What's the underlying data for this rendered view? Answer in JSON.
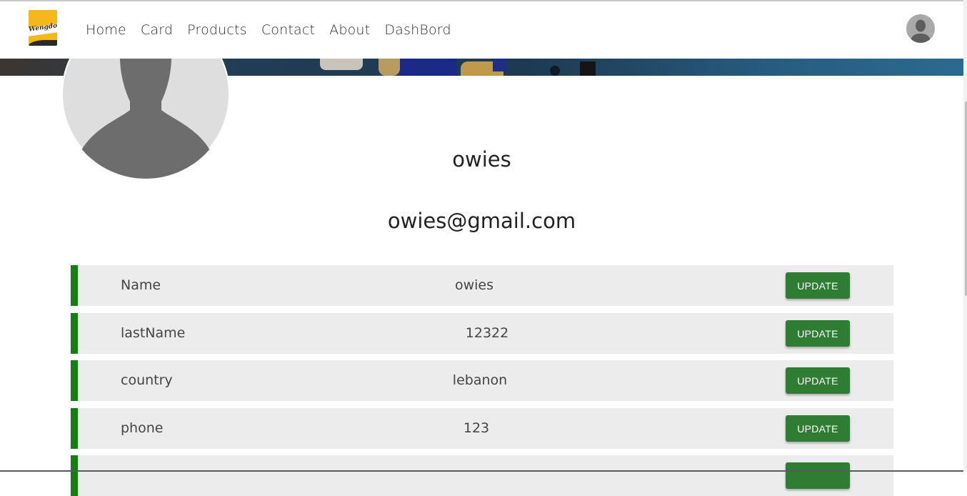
{
  "nav": {
    "logo_text": "Wengdo",
    "links": [
      "Home",
      "Card",
      "Products",
      "Contact",
      "About",
      "DashBord"
    ]
  },
  "profile": {
    "name": "owies",
    "email": "owies@gmail.com"
  },
  "rows": [
    {
      "label": "Name",
      "value": "owies",
      "button": "UPDATE"
    },
    {
      "label": "lastName",
      "value": "12322",
      "button": "UPDATE"
    },
    {
      "label": "country",
      "value": "lebanon",
      "button": "UPDATE"
    },
    {
      "label": "phone",
      "value": "123",
      "button": "UPDATE"
    },
    {
      "label": "",
      "value": "",
      "button": ""
    }
  ],
  "colors": {
    "accent_green": "#118011",
    "button_green": "#2e7d32",
    "row_bg": "#ececec"
  },
  "icons": [
    "user-avatar-icon",
    "profile-silhouette"
  ]
}
